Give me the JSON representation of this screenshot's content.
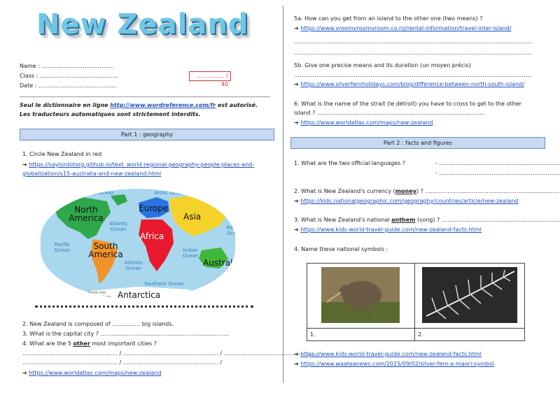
{
  "title": "New Zealand",
  "header": {
    "name_label": "Name : …………………………………",
    "class_label": "Class : ……………………………………",
    "date_label": "Date : ……………………………………",
    "score": "…………… / 40",
    "dictionary_note_1": "Seul le dictionnaire en ligne",
    "dictionary_link": "http://www.wordreference.com/fr",
    "dictionary_note_2": "est autorisé.",
    "translators_note": "Les traducteurs automatiques sont strictement interdits."
  },
  "part1": {
    "label": "Part 1 : geography",
    "q1": "1. Circle New Zealand in red",
    "q1_link_line1": "https://saylordotorg.github.io/text_world-regional-geography-people-places-and-",
    "q1_link_line2": "globalization/s15-australia-and-new-zealand.html",
    "map": {
      "continents": {
        "north_america": "North America",
        "south_america": "South America",
        "europe": "Europe",
        "asia": "Asia",
        "africa": "Africa",
        "australia": "Australia",
        "antarctica": "Antarctica"
      },
      "oceans": {
        "arctic_1": "Arctic Ocean",
        "arctic_2": "Arctic Ocean",
        "atlantic_1": "Atlantic Ocean",
        "atlantic_2": "Atlantic Ocean",
        "pacific_1": "Pacific Ocean",
        "pacific_2": "Pacific Ocean",
        "indian": "Indian Ocean",
        "southern": "Southern Ocean"
      },
      "credit_1": "© www.countries-of-the-world.com",
      "credit_2": "Free for personal and educational use"
    },
    "q2": "2. New Zealand is composed of …………… big islands.",
    "q3": "3. What is the capital city ? ……………………………………………………………",
    "q4_pre": "4. What are the 5",
    "q4_bold": "other",
    "q4_post": "most important cities ?",
    "q4_line1": "…………………………………………… / …………………………………………… / ……………………………………………",
    "q4_line2": "…………………………………………… / …………………………………………… /",
    "q4_link": "https://www.worldatlas.com/maps/new-zealand"
  },
  "part1b": {
    "q5a": "5a. How can you get from an island to the other one (two means) ?",
    "q5a_link": "https://www.vroomvroomvroom.co.nz/rental-information/travel-inter-island/",
    "dotline": "………………………………………………………………………………………………………………………………………………………………………",
    "q5b": "5b. Give one precise means and its duration (un moyen précis)",
    "q5b_link": "https://www.silverfernholidays.com/blog/difference-between-north-south-island/",
    "q6_line1": "6. What is the name of the strait (le détroit) you have to cross to get to the other",
    "q6_line2": "island ? ………………………………………………………………………………",
    "q6_link": "https://www.worldatlas.com/maps/new-zealand"
  },
  "part2": {
    "label": "Part 2 : facts and figures",
    "q1": "1. What are the two official languages ?",
    "q1_ans1": "- ……………………………………………………………",
    "q1_ans2": "- ……………………………………………………………",
    "q2_pre": "2. What is New Zealand's currency (",
    "q2_bold": "money",
    "q2_post": ") ? ………………………………………………………………………",
    "q2_link": "https://kids.nationalgeographic.com/geography/countries/article/new-zealand",
    "q3_pre": "3. What is New Zealand's national",
    "q3_bold": "anthem",
    "q3_post": "(song) ? ……………………………………………………………",
    "q3_link": "https://www.kids-world-travel-guide.com/new-zealand-facts.html",
    "q4": "4. Name these national symbols :",
    "symbol_1": "1.",
    "symbol_2": "2.",
    "link_a": "https://www.kids-world-travel-guide.com/new-zealand-facts.html",
    "link_b": "https://www.waateanews.com/2015/09/02/silver-fern-a-maori-symbol"
  },
  "arrow": "➔",
  "colors": {
    "title": "#6fc6e6",
    "part_bar": "#c5d9f1",
    "link": "#1a4fbf",
    "score": "#cc3333"
  }
}
